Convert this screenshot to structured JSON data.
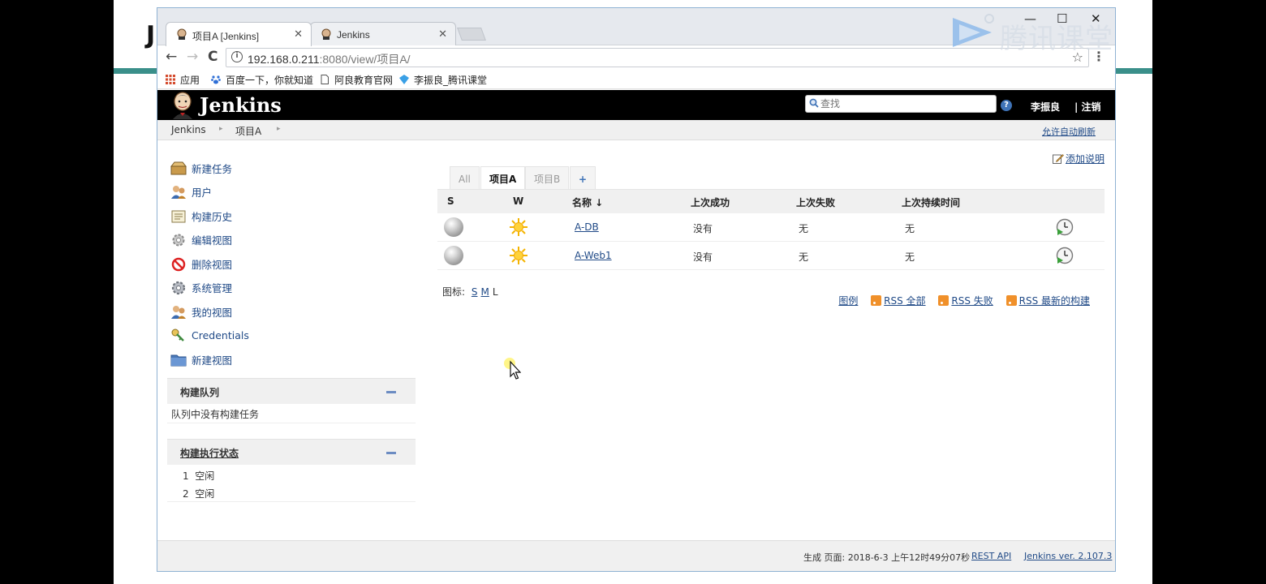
{
  "watermark": {
    "text": "腾讯课堂"
  },
  "slide": {
    "letter": "J"
  },
  "browser": {
    "tabs": [
      {
        "title": "项目A [Jenkins]",
        "active": true
      },
      {
        "title": "Jenkins",
        "active": false
      }
    ],
    "window_controls": {
      "minimize": "—",
      "maximize": "☐",
      "close": "✕"
    },
    "nav": {
      "back": "←",
      "forward": "→",
      "reload": "C"
    },
    "url": {
      "host": "192.168.0.211",
      "rest": ":8080/view/项目A/"
    },
    "bookmarks": [
      {
        "label": "应用",
        "icon": "apps-grid-icon"
      },
      {
        "label": "百度一下，你就知道",
        "icon": "baidu-paw-icon"
      },
      {
        "label": "阿良教育官网",
        "icon": "page-icon"
      },
      {
        "label": "李振良_腾讯课堂",
        "icon": "tencent-classroom-icon"
      }
    ]
  },
  "jenkins": {
    "brand": "Jenkins",
    "search_placeholder": "查找",
    "help": "?",
    "user": "李振良",
    "logout": "| 注销",
    "breadcrumbs": [
      "Jenkins",
      "项目A"
    ],
    "auto_refresh": "允许自动刷新",
    "tasks": [
      {
        "label": "新建任务",
        "icon": "new-item-icon"
      },
      {
        "label": "用户",
        "icon": "users-icon"
      },
      {
        "label": "构建历史",
        "icon": "build-history-icon"
      },
      {
        "label": "编辑视图",
        "icon": "edit-view-gear-icon"
      },
      {
        "label": "删除视图",
        "icon": "delete-view-icon"
      },
      {
        "label": "系统管理",
        "icon": "manage-gear-icon"
      },
      {
        "label": "我的视图",
        "icon": "my-views-icon"
      },
      {
        "label": "Credentials",
        "icon": "credentials-key-icon"
      },
      {
        "label": "新建视图",
        "icon": "new-view-folder-icon"
      }
    ],
    "build_queue": {
      "title": "构建队列",
      "empty": "队列中没有构建任务"
    },
    "executors": {
      "title": "构建执行状态",
      "items": [
        {
          "num": "1",
          "state": "空闲"
        },
        {
          "num": "2",
          "state": "空闲"
        }
      ]
    },
    "add_description": "添加说明",
    "view_tabs": [
      "All",
      "项目A",
      "项目B",
      "+"
    ],
    "active_view": "项目A",
    "columns": {
      "status": "S",
      "weather": "W",
      "name": "名称 ↓",
      "last_success": "上次成功",
      "last_failure": "上次失败",
      "last_duration": "上次持续时间"
    },
    "jobs": [
      {
        "name": "A-DB",
        "last_success": "没有",
        "last_failure": "无",
        "last_duration": "无",
        "status": "notbuilt-grey-ball",
        "weather": "sunny"
      },
      {
        "name": "A-Web1",
        "last_success": "没有",
        "last_failure": "无",
        "last_duration": "无",
        "status": "notbuilt-grey-ball",
        "weather": "sunny"
      }
    ],
    "icon_size": {
      "label": "图标:",
      "sizes": [
        "S",
        "M",
        "L"
      ],
      "current": "L"
    },
    "legend_links": {
      "legend": "图例",
      "rss_all": "RSS 全部",
      "rss_failed": "RSS 失败",
      "rss_latest": "RSS 最新的构建"
    },
    "footer": {
      "generated": "生成 页面: 2018-6-3 上午12时49分07秒",
      "rest_api": "REST API",
      "version": "Jenkins ver. 2.107.3"
    }
  },
  "colors": {
    "header_bg": "#000000",
    "link": "#204a87",
    "slide_accent": "#3a8f8a",
    "rss": "#f0902a"
  }
}
